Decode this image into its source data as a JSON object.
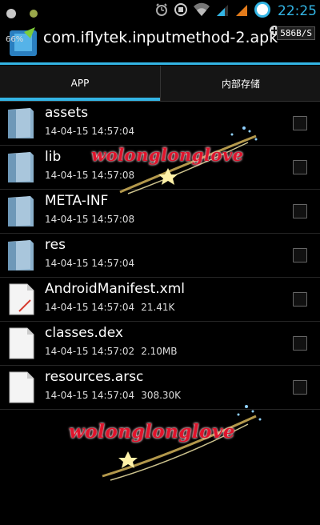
{
  "status_bar": {
    "clock": "22:25"
  },
  "header": {
    "title": "com.iflytek.inputmethod-2.apk",
    "battery_pct": "66%",
    "net_speed": "586B/S"
  },
  "tabs": [
    {
      "label": "APP",
      "selected": true
    },
    {
      "label": "内部存储",
      "selected": false
    }
  ],
  "files": [
    {
      "name": "assets",
      "date": "14-04-15 14:57:04",
      "size": "",
      "type": "folder"
    },
    {
      "name": "lib",
      "date": "14-04-15 14:57:08",
      "size": "",
      "type": "folder"
    },
    {
      "name": "META-INF",
      "date": "14-04-15 14:57:08",
      "size": "",
      "type": "folder"
    },
    {
      "name": "res",
      "date": "14-04-15 14:57:04",
      "size": "",
      "type": "folder"
    },
    {
      "name": "AndroidManifest.xml",
      "date": "14-04-15 14:57:04",
      "size": "21.41K",
      "type": "xml"
    },
    {
      "name": "classes.dex",
      "date": "14-04-15 14:57:02",
      "size": "2.10MB",
      "type": "file"
    },
    {
      "name": "resources.arsc",
      "date": "14-04-15 14:57:04",
      "size": "308.30K",
      "type": "file"
    }
  ],
  "watermark": {
    "text": "wolonglonglove"
  },
  "colors": {
    "accent": "#33b5e5",
    "watermark": "#e0142c"
  }
}
